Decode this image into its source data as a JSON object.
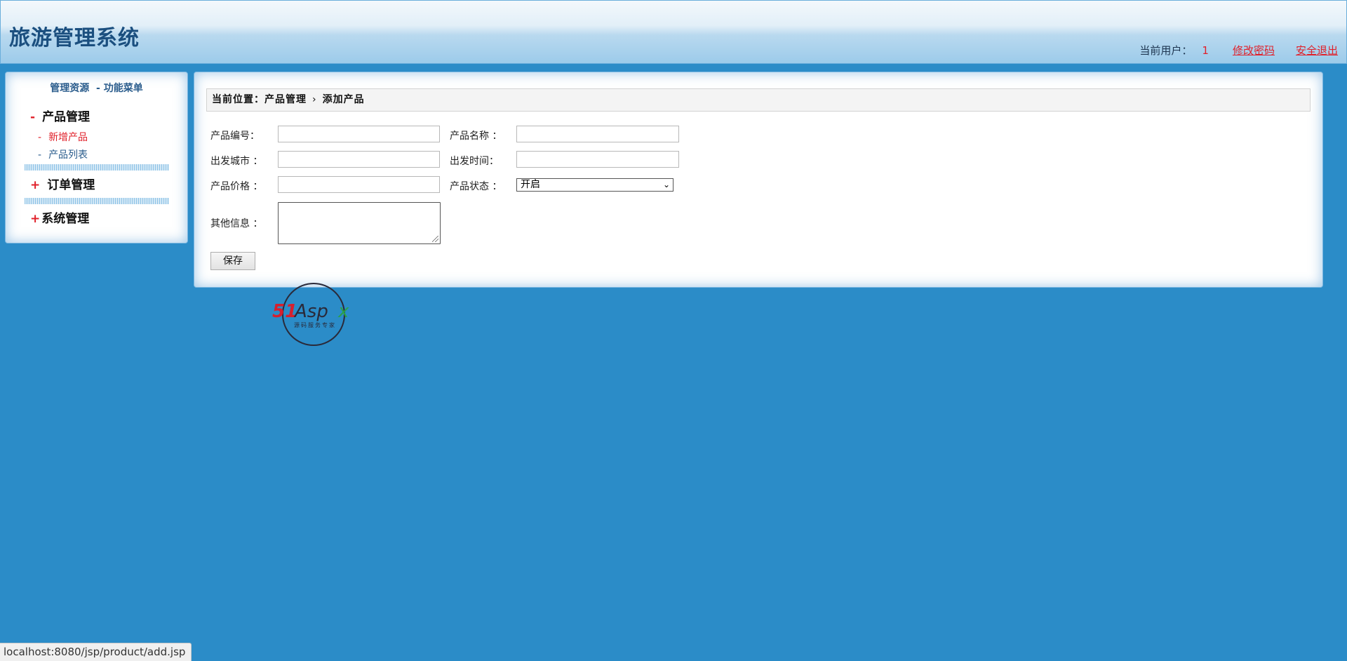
{
  "header": {
    "title": "旅游管理系统",
    "current_user_label": "当前用户：",
    "current_user_value": "1",
    "change_password": "修改密码",
    "logout": "安全退出"
  },
  "sidebar": {
    "title": "管理资源  - 功能菜单",
    "groups": [
      {
        "sign": "-",
        "label": "产品管理",
        "items": [
          {
            "label": "新增产品",
            "active": true
          },
          {
            "label": "产品列表",
            "active": false
          }
        ]
      },
      {
        "sign": "+",
        "label": "订单管理"
      },
      {
        "sign": "+",
        "label": "系统管理"
      }
    ],
    "item_dash": "-"
  },
  "main": {
    "breadcrumb": {
      "prefix": "当前位置：",
      "section": "产品管理",
      "separator": "›",
      "page": "添加产品"
    },
    "form": {
      "product_no_label": "产品编号：",
      "product_name_label": "产品名称 ：",
      "departure_city_label": "出发城市 ：",
      "departure_time_label": "出发时间：",
      "price_label": "产品价格 ：",
      "status_label": "产品状态 ：",
      "status_value": "开启",
      "other_info_label": "其他信息 ：",
      "product_no_value": "",
      "product_name_value": "",
      "departure_city_value": "",
      "departure_time_value": "",
      "price_value": ""
    },
    "save_label": "保存"
  },
  "watermark": {
    "text": "51Aspx",
    "subtext": "源码服务专家"
  },
  "statusbar": {
    "url": "localhost:8080/jsp/product/add.jsp"
  },
  "colors": {
    "background": "#2b8cc8",
    "accent_red": "#e0202a",
    "title_blue": "#1b4f7f"
  }
}
